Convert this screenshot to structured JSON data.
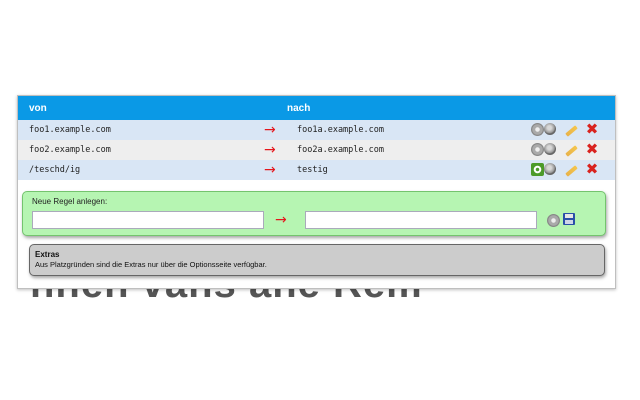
{
  "background_text": "hnen vans ane Rem",
  "table": {
    "header_from": "von",
    "header_to": "nach",
    "arrow": "→",
    "rows": [
      {
        "from": "foo1.example.com",
        "to": "foo1a.example.com",
        "active": false
      },
      {
        "from": "foo2.example.com",
        "to": "foo2a.example.com",
        "active": false
      },
      {
        "from": "/teschd/ig",
        "to": "testig",
        "active": true
      }
    ]
  },
  "new_rule": {
    "label": "Neue Regel anlegen:",
    "from_value": "",
    "to_value": ""
  },
  "extras": {
    "title": "Extras",
    "description": "Aus Platzgründen sind die Extras nur über die Optionsseite verfügbar."
  },
  "colors": {
    "header": "#0a99e6",
    "arrow": "#e4161c",
    "new_rule_box": "#b6f5b2",
    "extras_box": "#cccccc",
    "delete": "#d9231f"
  }
}
